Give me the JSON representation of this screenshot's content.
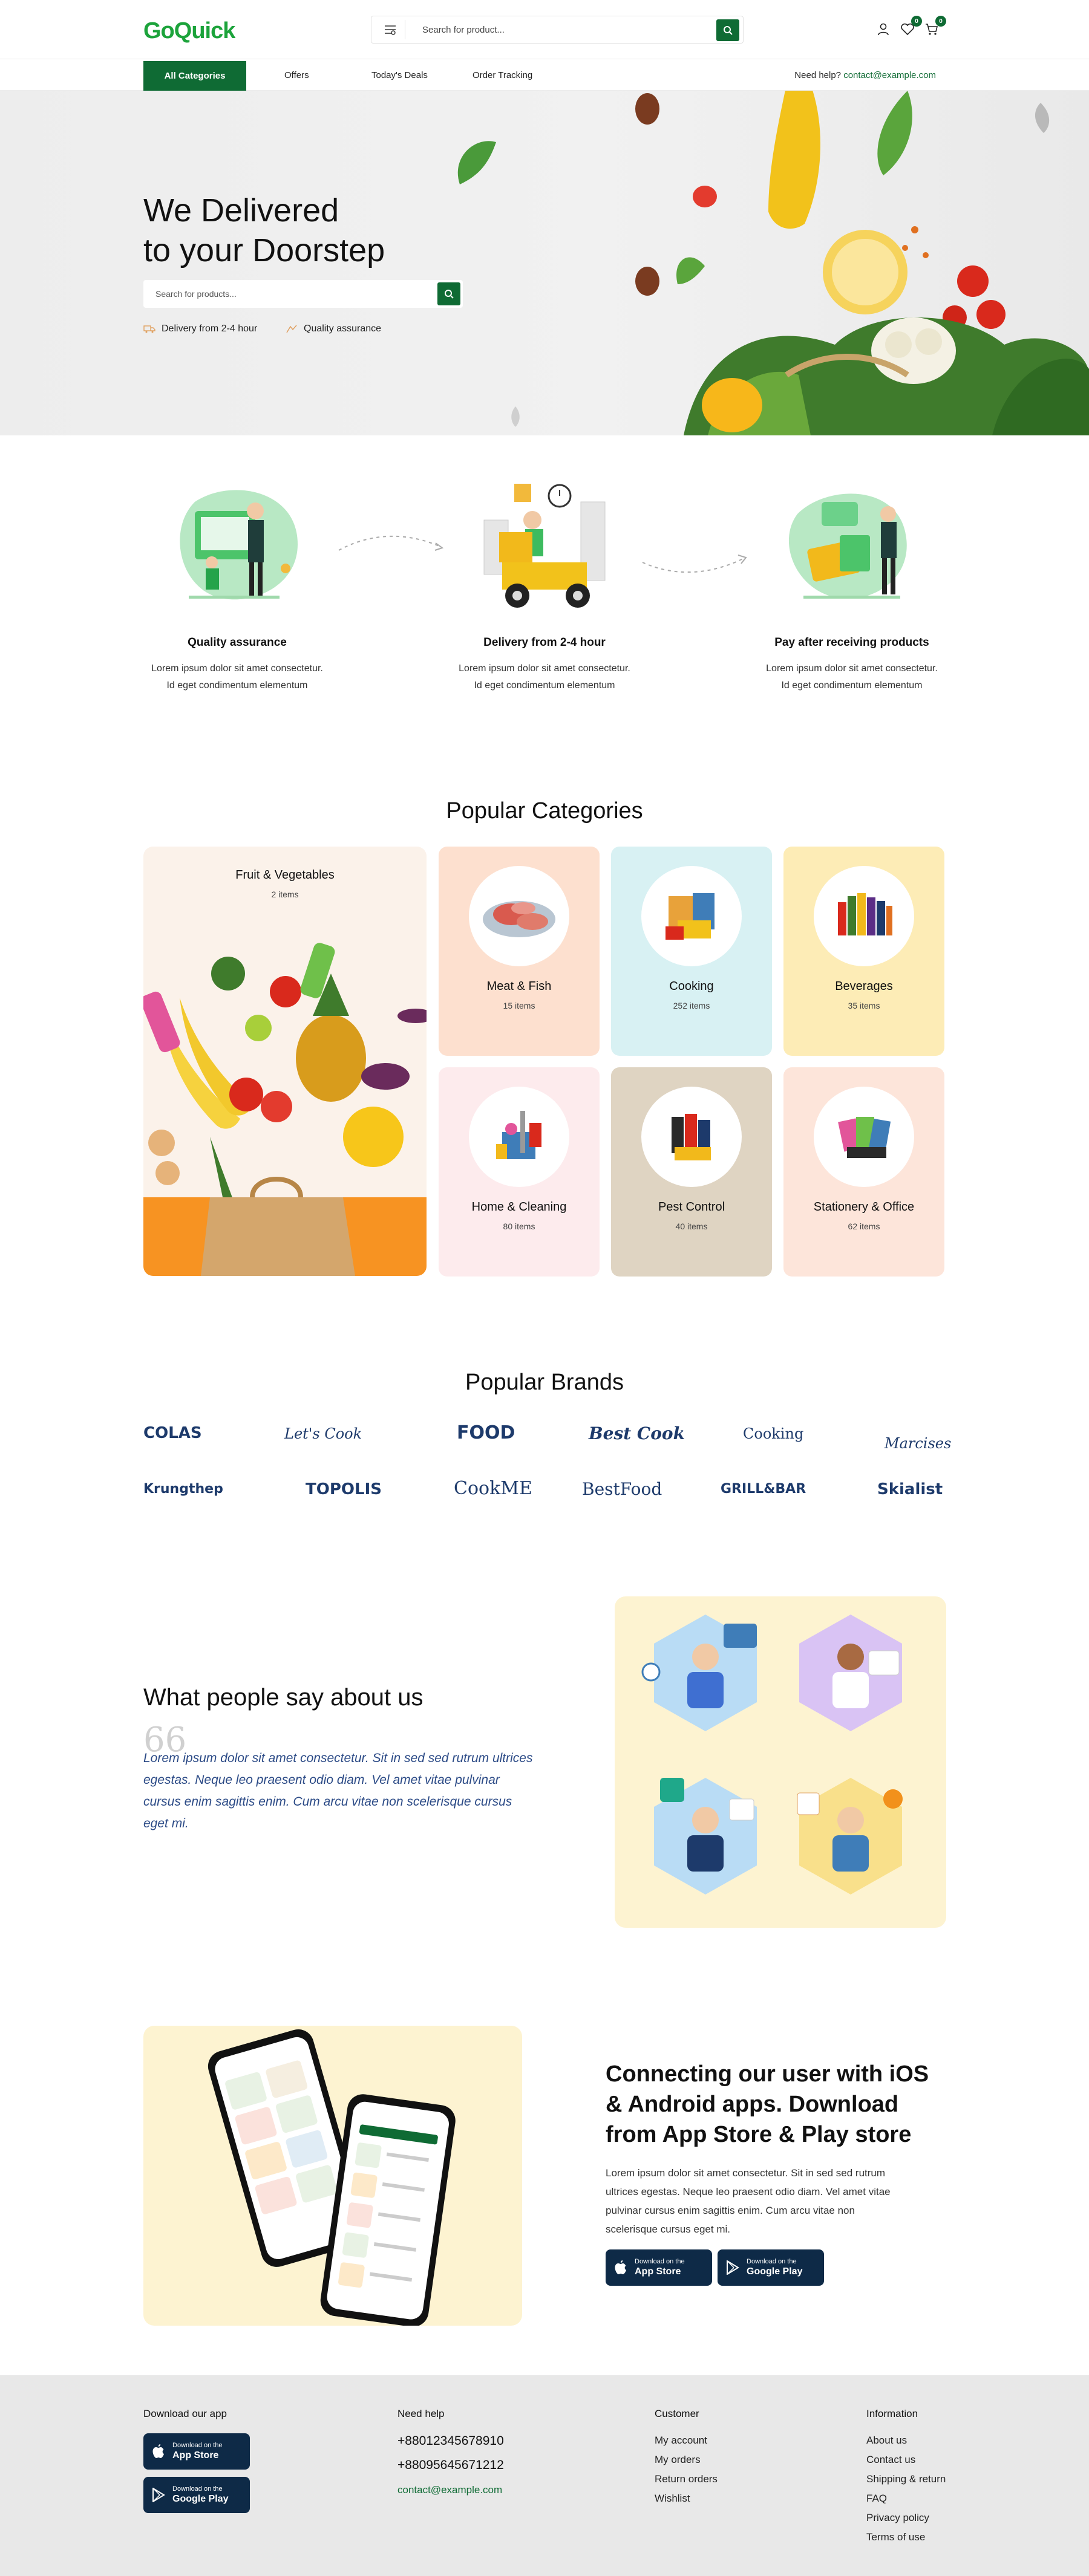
{
  "header": {
    "logo_text": "GoQuick",
    "search_placeholder": "Search for product...",
    "wishlist_count": "0",
    "cart_count": "0"
  },
  "nav": {
    "all_categories": "All Categories",
    "links": [
      "Offers",
      "Today's Deals",
      "Order Tracking"
    ],
    "help_label": "Need help?",
    "help_email": "contact@example.com"
  },
  "hero": {
    "title_line1": "We Delivered",
    "title_line2": "to your Doorstep",
    "search_placeholder": "Search for products...",
    "feature1": "Delivery from 2-4 hour",
    "feature2": "Quality assurance"
  },
  "steps": [
    {
      "title": "Quality assurance",
      "desc1": "Lorem ipsum dolor sit amet consectetur.",
      "desc2": "Id eget condimentum elementum"
    },
    {
      "title": "Delivery from 2-4 hour",
      "desc1": "Lorem ipsum dolor sit amet consectetur.",
      "desc2": "Id eget condimentum elementum"
    },
    {
      "title": "Pay after receiving products",
      "desc1": "Lorem ipsum dolor sit amet consectetur.",
      "desc2": "Id eget condimentum elementum"
    }
  ],
  "categories": {
    "title": "Popular Categories",
    "featured": {
      "name": "Fruit & Vegetables",
      "count": "2 items"
    },
    "items": [
      {
        "name": "Meat & Fish",
        "count": "15 items",
        "bg": "#fde0cf"
      },
      {
        "name": "Cooking",
        "count": "252 items",
        "bg": "#d8f1f3"
      },
      {
        "name": "Beverages",
        "count": "35 items",
        "bg": "#fdecb6"
      },
      {
        "name": "Home & Cleaning",
        "count": "80 items",
        "bg": "#fdebed"
      },
      {
        "name": "Pest Control",
        "count": "40 items",
        "bg": "#dfd4c2"
      },
      {
        "name": "Stationery & Office",
        "count": "62 items",
        "bg": "#fde5da"
      }
    ]
  },
  "brands": {
    "title": "Popular Brands",
    "row1": [
      "COLAS",
      "Let's Cook",
      "FOOD",
      "Best Cook",
      "Cooking",
      "Marcises"
    ],
    "row2": [
      "Krungthep",
      "TOPOLIS",
      "CookME",
      "BestFood",
      "GRILL&BAR",
      "Skialist"
    ]
  },
  "testimonial": {
    "title": "What people say about us",
    "quote_mark": "66",
    "text": "Lorem ipsum dolor sit amet consectetur. Sit in sed sed rutrum ultrices egestas. Neque leo praesent odio diam. Vel amet vitae pulvinar cursus enim sagittis enim. Cum arcu vitae non scelerisque cursus eget mi."
  },
  "app": {
    "title": "Connecting our user with iOS & Android apps. Download from App Store & Play store",
    "desc": "Lorem ipsum dolor sit amet consectetur. Sit in sed sed rutrum ultrices egestas. Neque leo praesent odio diam. Vel amet vitae pulvinar cursus enim sagittis enim. Cum arcu vitae non scelerisque cursus eget mi.",
    "appstore_small": "Download on the",
    "appstore_big": "App Store",
    "play_small": "Download on the",
    "play_big": "Google Play"
  },
  "footer": {
    "download_heading": "Download our app",
    "help_heading": "Need help",
    "phone1": "+88012345678910",
    "phone2": "+88095645671212",
    "email": "contact@example.com",
    "customer_heading": "Customer",
    "customer_links": [
      "My account",
      "My orders",
      "Return orders",
      "Wishlist"
    ],
    "info_heading": "Information",
    "info_links": [
      "About us",
      "Contact us",
      "Shipping & return",
      "FAQ",
      "Privacy policy",
      "Terms of use"
    ]
  },
  "colors": {
    "primary": "#0f6b34",
    "logo_green": "#1ca33b",
    "brand_navy": "#1d3a6b",
    "store_button": "#0e2a47"
  }
}
